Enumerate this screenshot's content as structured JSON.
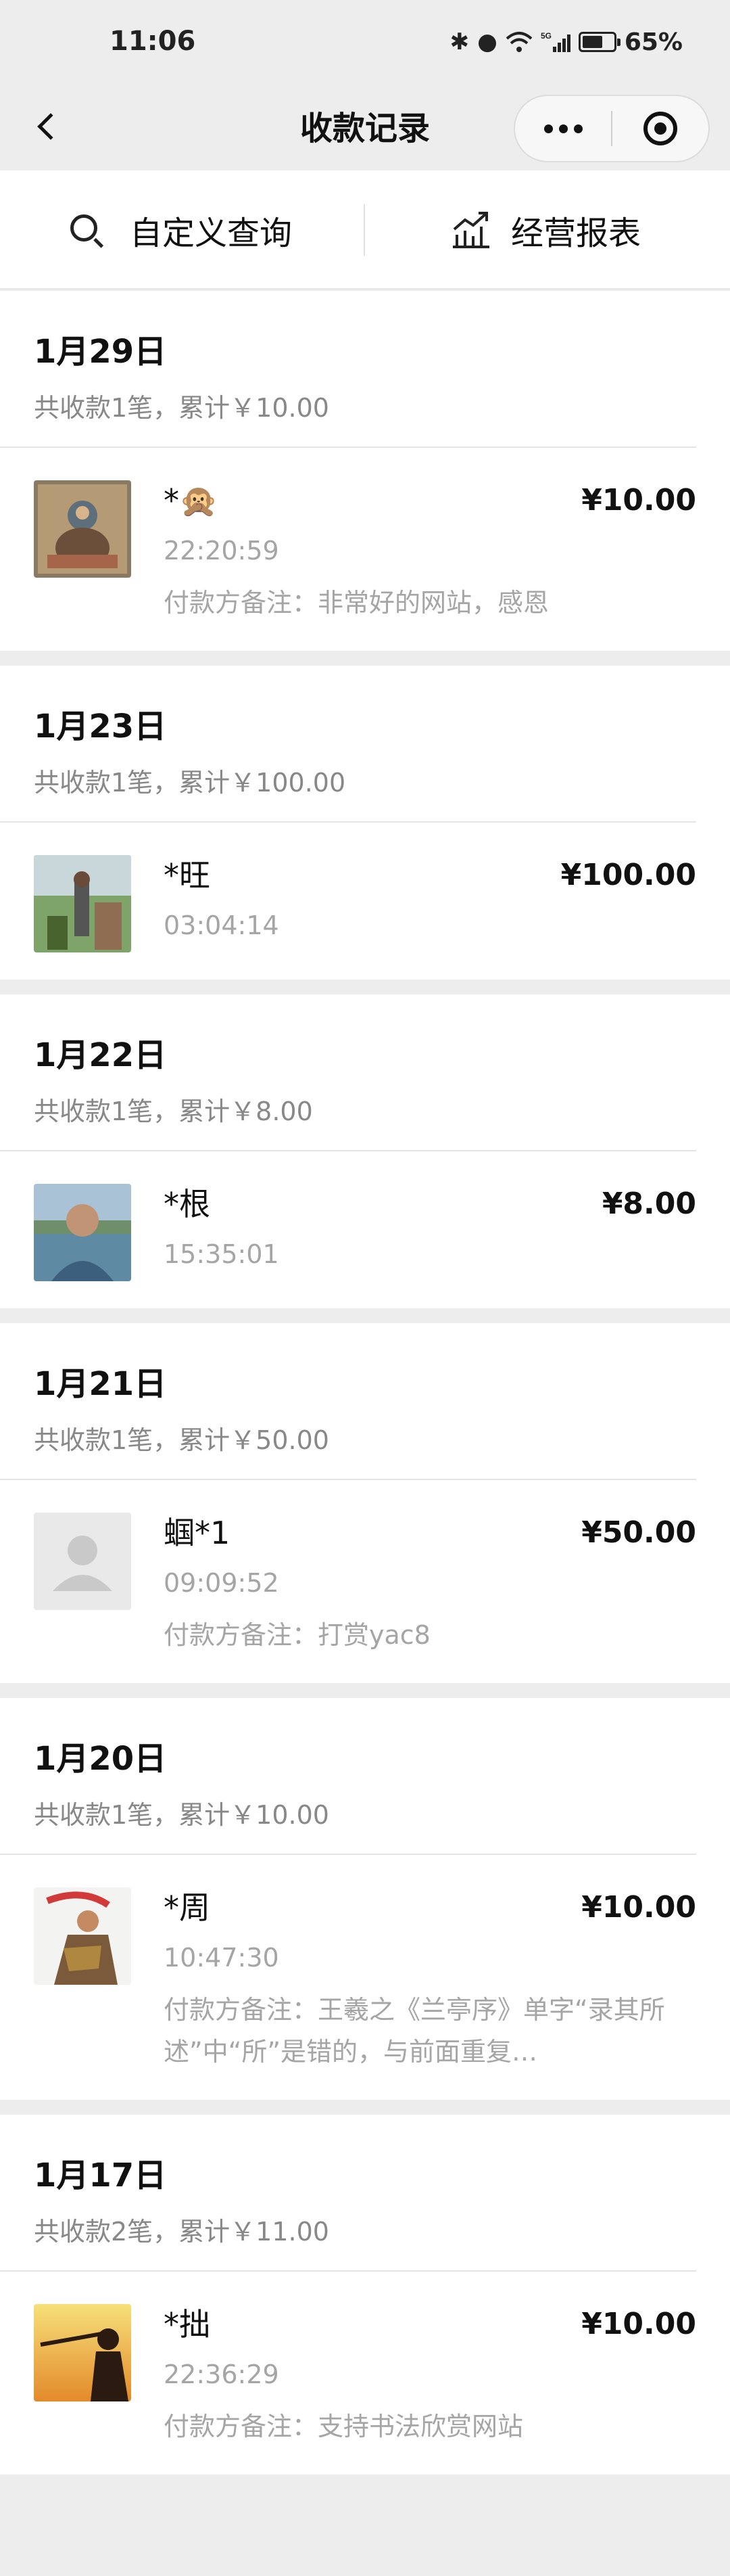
{
  "status_bar": {
    "time": "11:06",
    "battery": "65%",
    "battery_level": 0.65,
    "network": "5G"
  },
  "nav": {
    "title": "收款记录"
  },
  "toolbar": {
    "custom_query": "自定义查询",
    "business_report": "经营报表"
  },
  "groups": [
    {
      "date": "1月29日",
      "summary": "共收款1笔，累计￥10.00",
      "records": [
        {
          "name": "*🙊",
          "amount": "¥10.00",
          "time": "22:20:59",
          "note": "付款方备注：非常好的网站，感恩",
          "avatar": "thangka"
        }
      ]
    },
    {
      "date": "1月23日",
      "summary": "共收款1笔，累计￥100.00",
      "records": [
        {
          "name": "*旺",
          "amount": "¥100.00",
          "time": "03:04:14",
          "note": "",
          "avatar": "outdoor-statue"
        }
      ]
    },
    {
      "date": "1月22日",
      "summary": "共收款1笔，累计￥8.00",
      "records": [
        {
          "name": "*根",
          "amount": "¥8.00",
          "time": "15:35:01",
          "note": "",
          "avatar": "man-by-lake"
        }
      ]
    },
    {
      "date": "1月21日",
      "summary": "共收款1笔，累计￥50.00",
      "records": [
        {
          "name": "蝈*1",
          "amount": "¥50.00",
          "time": "09:09:52",
          "note": "付款方备注：打赏yac8",
          "avatar": "default"
        }
      ]
    },
    {
      "date": "1月20日",
      "summary": "共收款1笔，累计￥10.00",
      "records": [
        {
          "name": "*周",
          "amount": "¥10.00",
          "time": "10:47:30",
          "note": "付款方备注：王羲之《兰亭序》单字“录其所述”中“所”是错的，与前面重复…",
          "avatar": "costume-dancer"
        }
      ]
    },
    {
      "date": "1月17日",
      "summary": "共收款2笔，累计￥11.00",
      "records": [
        {
          "name": "*拙",
          "amount": "¥10.00",
          "time": "22:36:29",
          "note": "付款方备注：支持书法欣赏网站",
          "avatar": "sunset-silhouette"
        }
      ]
    }
  ]
}
